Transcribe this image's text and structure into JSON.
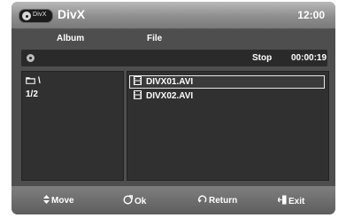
{
  "header": {
    "badge_text": "DivX",
    "title": "DivX",
    "clock": "12:00"
  },
  "columns": {
    "album": "Album",
    "file": "File"
  },
  "status": {
    "state": "Stop",
    "time": "00:00:19"
  },
  "album_panel": {
    "folder": "\\",
    "page": "1/2"
  },
  "files": [
    {
      "name": "DIVX01.AVI",
      "selected": true
    },
    {
      "name": "DIVX02.AVI",
      "selected": false
    }
  ],
  "footer": {
    "move": "Move",
    "ok": "Ok",
    "return": "Return",
    "exit": "Exit"
  },
  "icons": {
    "disc": "disc-icon",
    "folder": "folder-icon",
    "file": "film-icon",
    "move": "up-down-arrows-icon",
    "ok": "enter-icon",
    "return": "return-icon",
    "exit": "exit-icon"
  }
}
